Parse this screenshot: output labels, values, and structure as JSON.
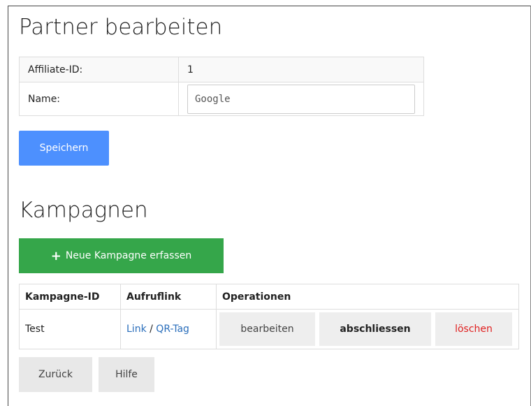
{
  "page": {
    "title": "Partner bearbeiten",
    "save_label": "Speichern",
    "campaigns_title": "Kampagnen",
    "new_campaign_label": "Neue Kampagne erfassen",
    "back_label": "Zurück",
    "help_label": "Hilfe"
  },
  "partner": {
    "affiliate_label": "Affiliate-ID:",
    "affiliate_value": "1",
    "name_label": "Name:",
    "name_value": "Google"
  },
  "campaigns": {
    "headers": [
      "Kampagne-ID",
      "Aufruflink",
      "Operationen"
    ],
    "rows": [
      {
        "id": "Test",
        "link_label": "Link",
        "separator": "/",
        "qr_label": "QR-Tag",
        "edit_label": "bearbeiten",
        "close_label": "abschliessen",
        "delete_label": "löschen"
      }
    ]
  },
  "colors": {
    "save": "#4d90fe",
    "new": "#35a64a",
    "delete_text": "#e02020",
    "link": "#2a6ebb"
  },
  "icons": {
    "new_campaign": "plus-icon"
  }
}
